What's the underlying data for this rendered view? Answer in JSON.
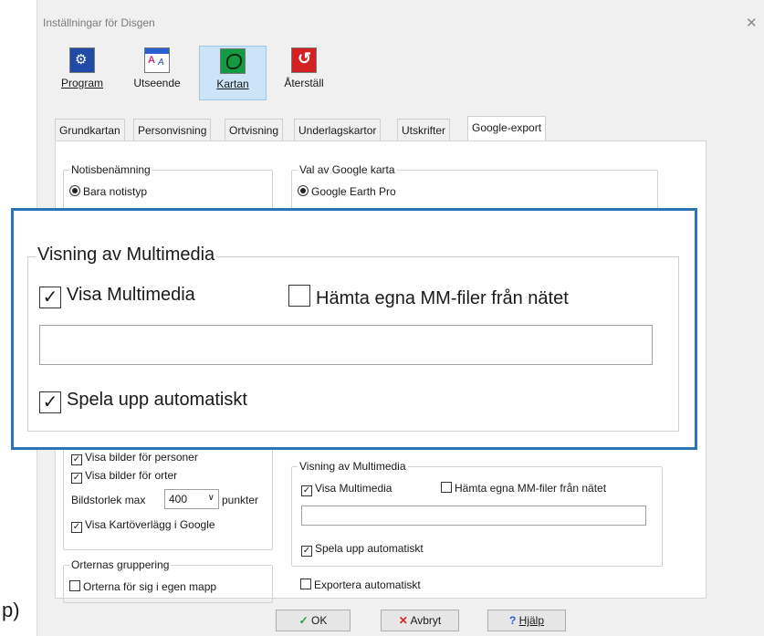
{
  "window": {
    "title": "Inställningar för Disgen"
  },
  "toolbar": [
    {
      "label": "Program"
    },
    {
      "label": "Utseende"
    },
    {
      "label": "Kartan"
    },
    {
      "label": "Återställ"
    }
  ],
  "tabs": [
    "Grundkartan",
    "Personvisning",
    "Ortvisning",
    "Underlagskartor",
    "Utskrifter",
    "Google-export"
  ],
  "notis": {
    "legend": "Notisbenämning",
    "option": "Bara notistyp"
  },
  "google_map": {
    "legend": "Val av Google karta",
    "option": "Google Earth Pro"
  },
  "images": {
    "persons": "Visa bilder för personer",
    "places": "Visa bilder för orter",
    "size_label": "Bildstorlek max",
    "size_value": "400",
    "size_unit": "punkter",
    "overlay": "Visa Kartöverlägg i Google"
  },
  "grouping": {
    "legend": "Orternas gruppering",
    "option": "Orterna för sig i egen mapp"
  },
  "multimedia": {
    "legend": "Visning av  Multimedia",
    "show": "Visa Multimedia",
    "fetch": "Hämta egna MM-filer från nätet",
    "path": "",
    "autoplay": "Spela upp  automatiskt"
  },
  "export_auto": "Exportera automatiskt",
  "buttons": {
    "ok": "OK",
    "cancel": "Avbryt",
    "help": "Hjälp"
  },
  "caption": "p)",
  "colors": {
    "highlight_border": "#2e74b5",
    "selected_toolbar": "#cce4f7"
  }
}
